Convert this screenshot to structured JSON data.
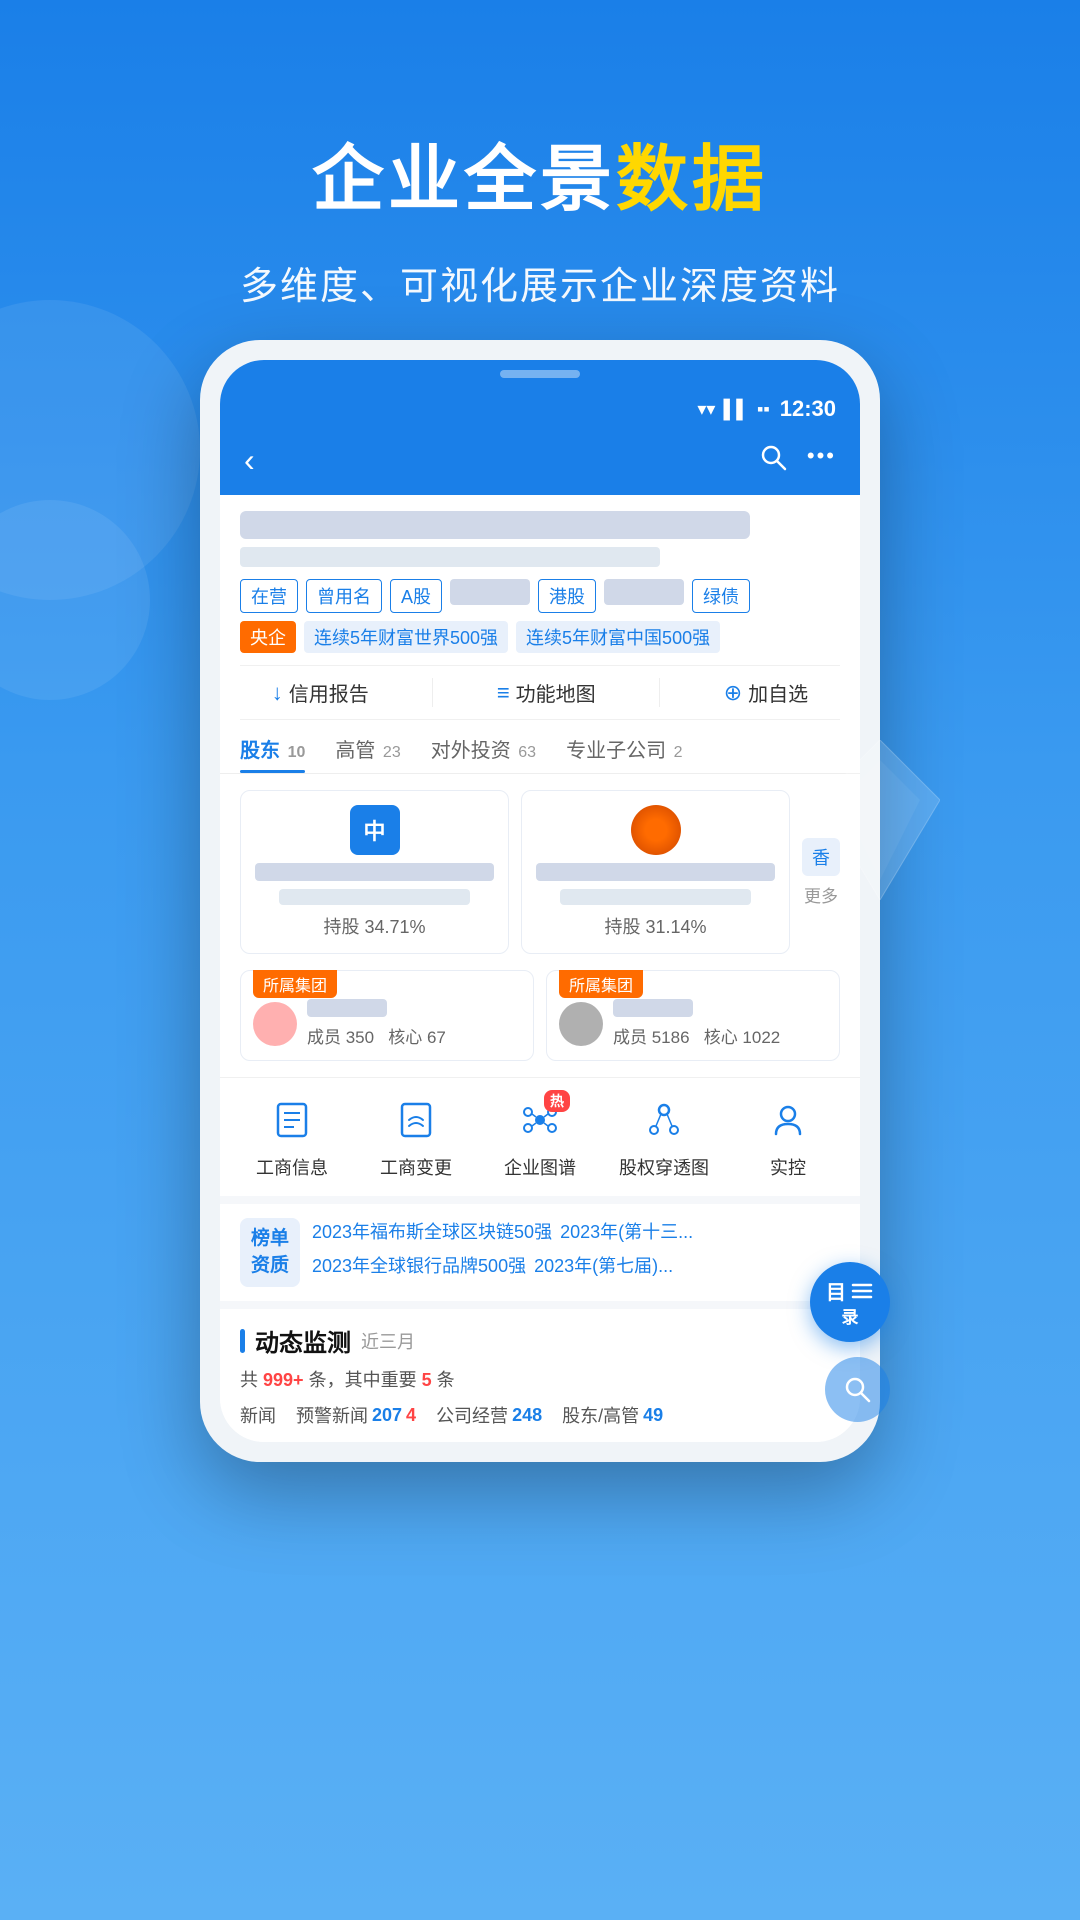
{
  "page": {
    "background_gradient_start": "#1a7fe8",
    "background_gradient_end": "#5ab0f5"
  },
  "header": {
    "title_part1": "企业全景",
    "title_part2": "数据",
    "subtitle": "多维度、可视化展示企业深度资料"
  },
  "status_bar": {
    "time": "12:30",
    "wifi": "▼",
    "signal": "▲",
    "battery": "▪"
  },
  "nav": {
    "back_icon": "‹",
    "search_icon": "○",
    "more_icon": "···"
  },
  "company": {
    "name_placeholder": "company_name_blurred",
    "tags": [
      "在营",
      "曾用名",
      "A股",
      "港股",
      "绿债"
    ],
    "tags2": [
      "央企",
      "连续5年财富世界500强",
      "连续5年财富中国500强"
    ],
    "actions": [
      {
        "icon": "↓",
        "label": "信用报告"
      },
      {
        "icon": "≡",
        "label": "功能地图"
      },
      {
        "icon": "⊕",
        "label": "加自选"
      }
    ]
  },
  "tabs": [
    {
      "label": "股东",
      "badge": "10",
      "active": true
    },
    {
      "label": "高管",
      "badge": "23",
      "active": false
    },
    {
      "label": "对外投资",
      "badge": "63",
      "active": false
    },
    {
      "label": "专业子公司",
      "badge": "2",
      "active": false
    }
  ],
  "shareholders": [
    {
      "avatar_text": "中",
      "percent": "持股 34.71%"
    },
    {
      "avatar_type": "image",
      "percent": "持股 31.14%"
    },
    {
      "label": "香",
      "more": "更多"
    }
  ],
  "groups": [
    {
      "badge": "所属集团",
      "avatar_color": "#ffb0b0",
      "members": "成员 350",
      "core": "核心 67"
    },
    {
      "badge": "所属集团",
      "avatar_color": "#b0b0b0",
      "members": "成员 5186",
      "core": "核心 1022"
    }
  ],
  "features": [
    {
      "icon": "📋",
      "label": "工商信息",
      "hot": false
    },
    {
      "icon": "🔄",
      "label": "工商变更",
      "hot": false
    },
    {
      "icon": "🔗",
      "label": "企业图谱",
      "hot": true
    },
    {
      "icon": "🔍",
      "label": "股权穿透图",
      "hot": false
    },
    {
      "icon": "👤",
      "label": "实控",
      "hot": false
    }
  ],
  "rankings": {
    "section_title": "榜单\n资质",
    "items": [
      "2023年福布斯全球区块链50强",
      "2023年(第十三...",
      "2023年全球银行品牌500强",
      "2023年(第七届)..."
    ]
  },
  "dynamic": {
    "title": "动态监测",
    "period": "近三月",
    "total": "999+",
    "important": "5",
    "items": [
      {
        "label": "新闻",
        "value": ""
      },
      {
        "label": "预警新闻",
        "value": "207",
        "warn": "4"
      },
      {
        "label": "公司经营",
        "value": "248"
      },
      {
        "label": "股东/高管",
        "value": "49"
      }
    ]
  },
  "float_buttons": [
    {
      "label1": "目",
      "label2": "录",
      "icon": "≡"
    },
    {
      "label": ""
    }
  ]
}
